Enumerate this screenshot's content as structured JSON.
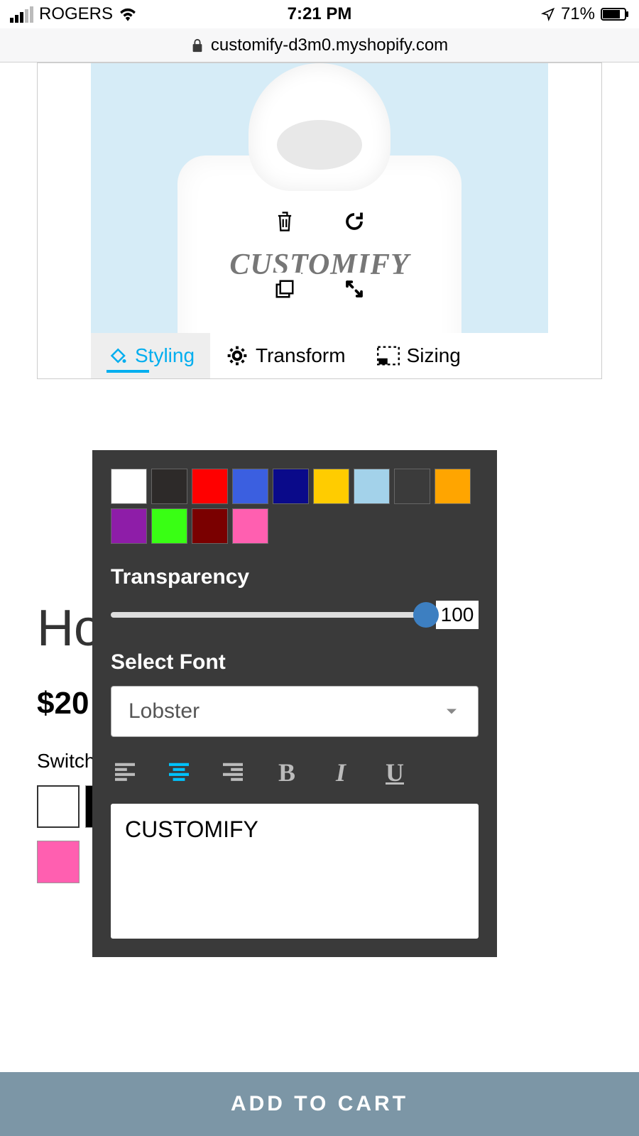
{
  "status": {
    "carrier": "ROGERS",
    "time": "7:21 PM",
    "battery": "71%"
  },
  "url": "customify-d3m0.myshopify.com",
  "design_text": "CUSTOMIFY",
  "tabs": {
    "styling": "Styling",
    "transform": "Transform",
    "sizing": "Sizing"
  },
  "panel": {
    "colors": [
      "#ffffff",
      "#2d2a29",
      "#ff0000",
      "#3b5fe0",
      "#0a0a8a",
      "#ffcc00",
      "#a3d2ea",
      "#3b3b3b",
      "#ffa500",
      "#8e1da8",
      "#39ff14",
      "#7a0000",
      "#ff5fb0"
    ],
    "transparency_label": "Transparency",
    "transparency_value": "100",
    "font_label": "Select Font",
    "font_value": "Lobster",
    "text_value": "CUSTOMIFY"
  },
  "product": {
    "title": "Hoodies",
    "price": "$20",
    "switch_label": "Switch",
    "variants": [
      "#ffffff",
      "#000000",
      "#333333",
      "#555555",
      "#777777",
      "#4b0082",
      "#004d00",
      "#660000",
      "#ff5fb0"
    ]
  },
  "cta": "ADD TO CART"
}
